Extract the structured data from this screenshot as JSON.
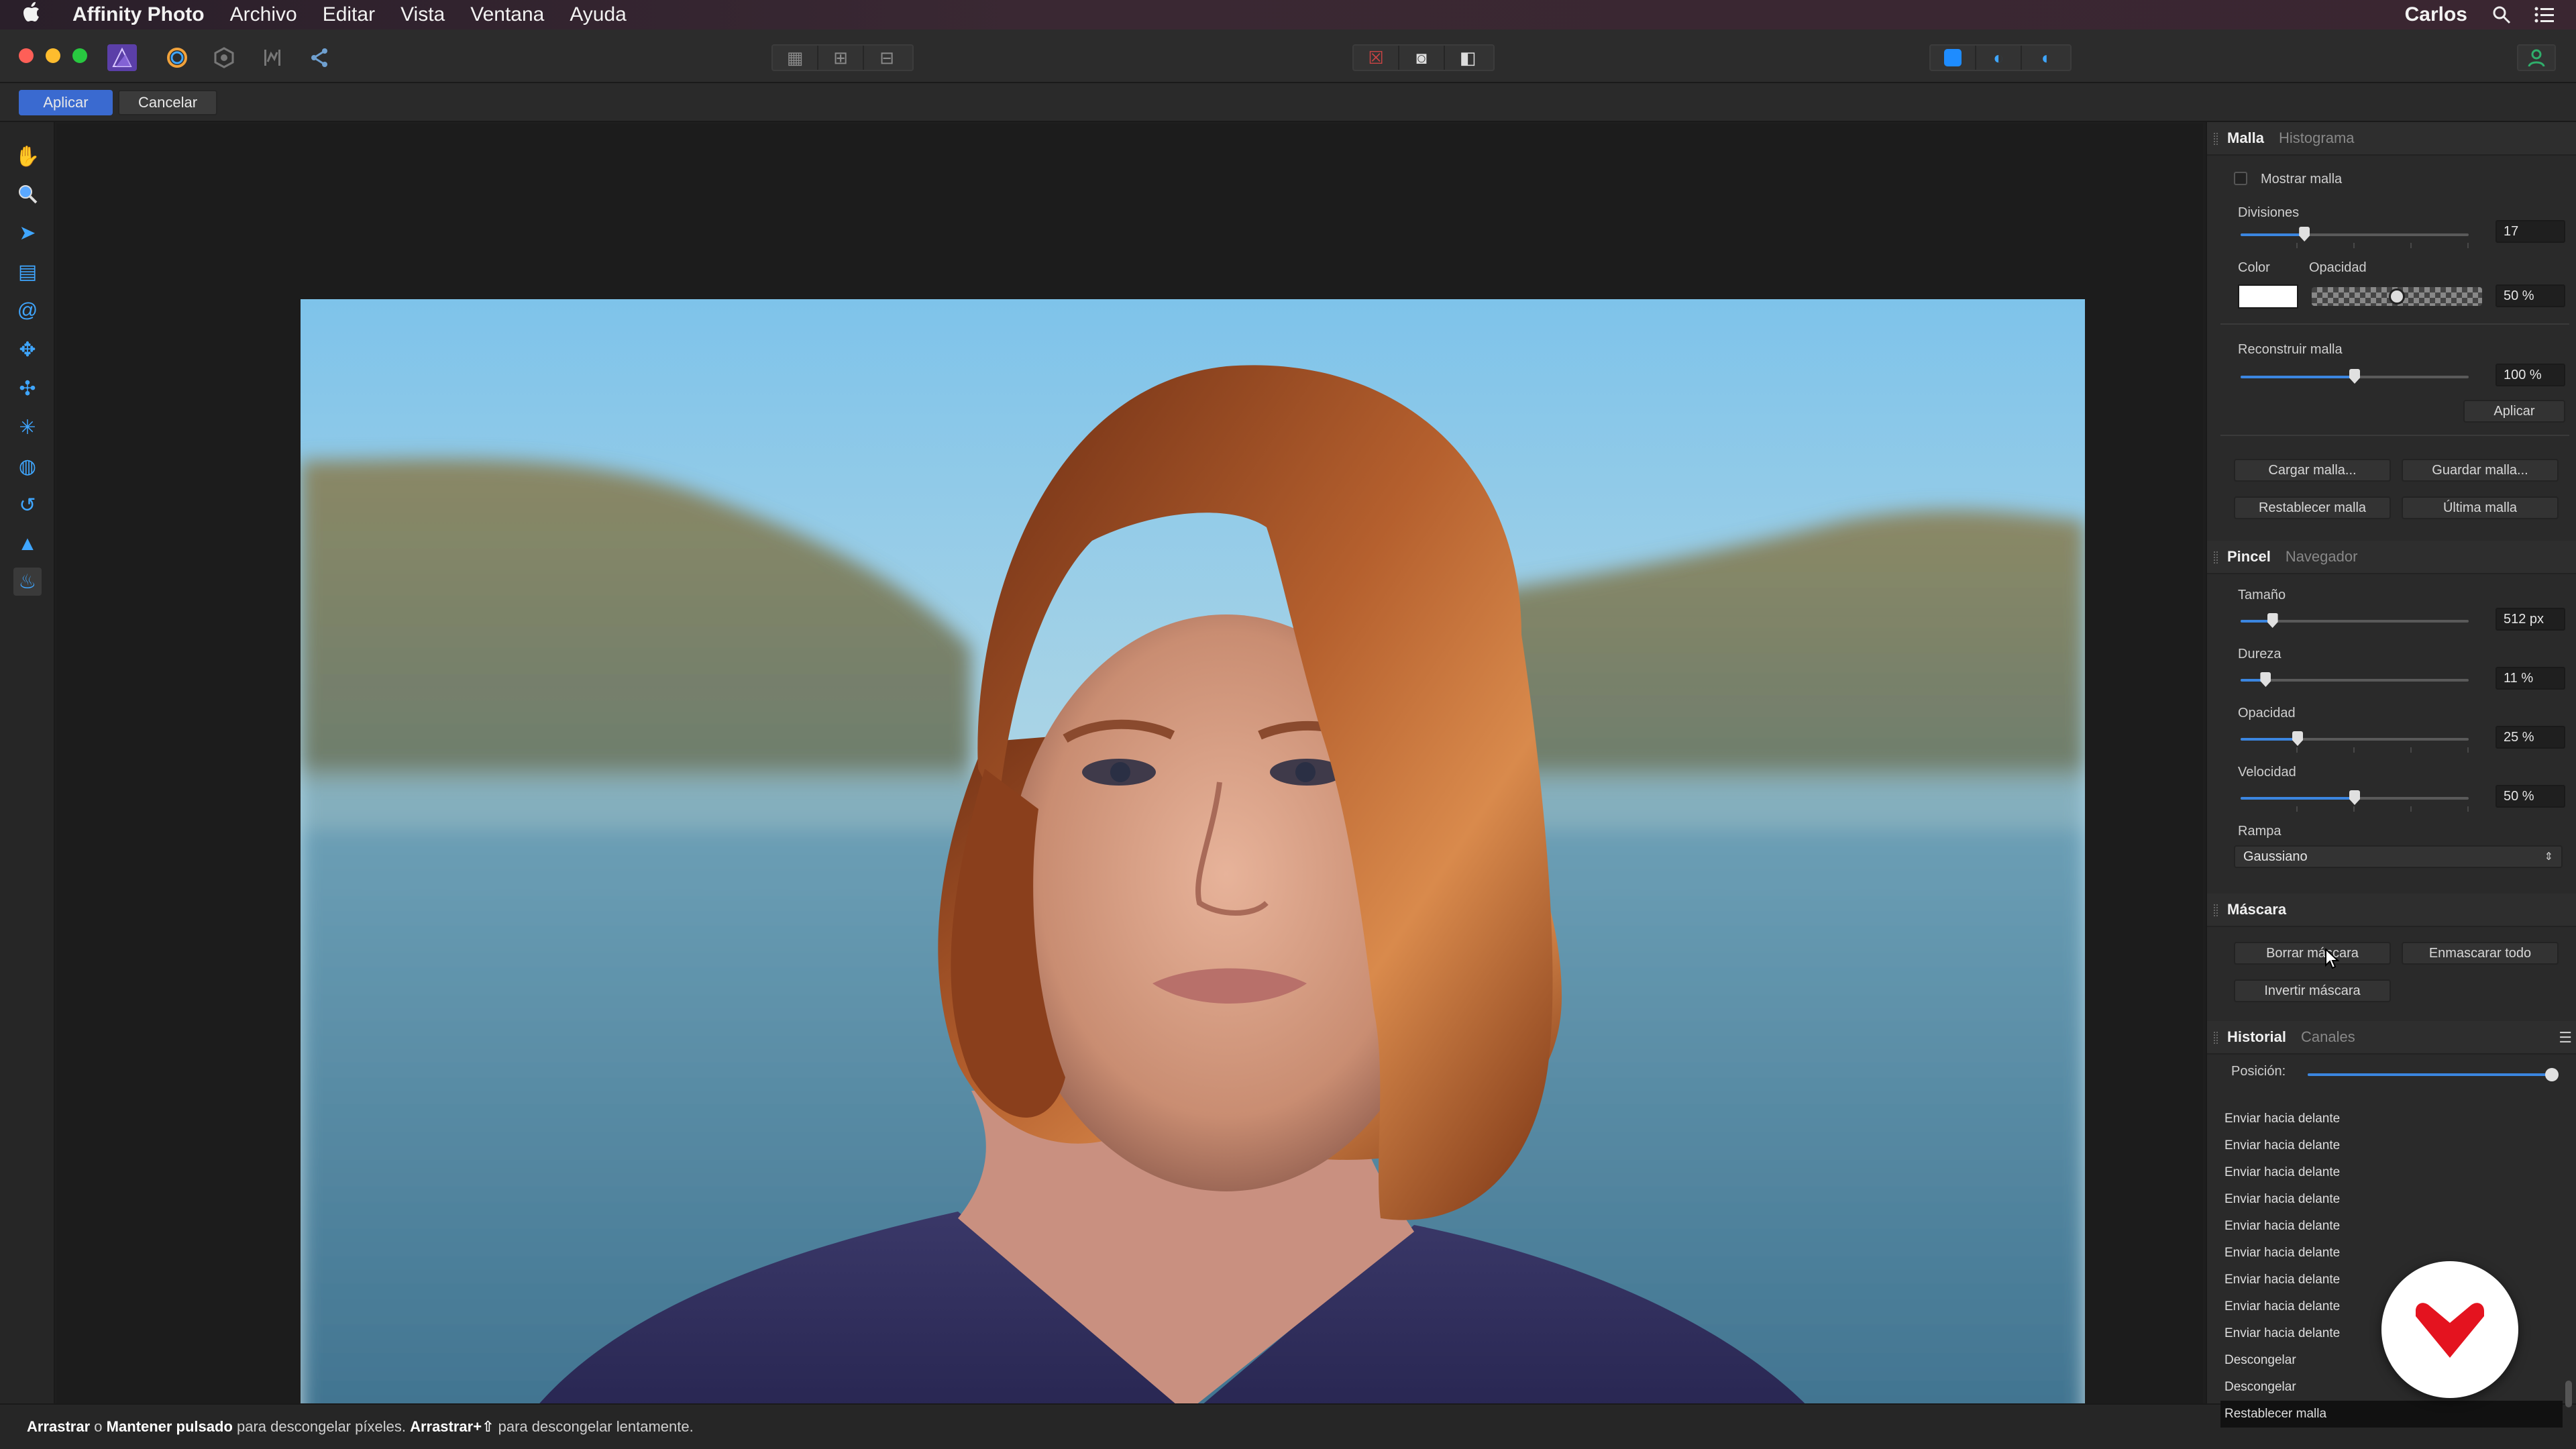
{
  "menubar": {
    "apple": "",
    "app_name": "Affinity Photo",
    "items": [
      "Archivo",
      "Editar",
      "Vista",
      "Ventana",
      "Ayuda"
    ],
    "user": "Carlos"
  },
  "context": {
    "apply": "Aplicar",
    "cancel": "Cancelar"
  },
  "status": {
    "drag": "Arrastrar",
    "o": " o ",
    "hold": "Mantener pulsado",
    "text1": " para descongelar píxeles. ",
    "drag_shift": "Arrastrar+⇧",
    "text2": " para descongelar lentamente."
  },
  "mesh_panel": {
    "tabs": [
      "Malla",
      "Histograma"
    ],
    "show_mesh": "Mostrar malla",
    "divisions_label": "Divisiones",
    "divisions_value": "17",
    "divisions_level": 0.28,
    "color_label": "Color",
    "color_value": "#ffffff",
    "opacity_label": "Opacidad",
    "opacity_value": "50 %",
    "opacity_level": 0.5,
    "rebuild_label": "Reconstruir malla",
    "rebuild_value": "100 %",
    "rebuild_level": 0.5,
    "apply": "Aplicar",
    "load": "Cargar malla...",
    "save": "Guardar malla...",
    "reset": "Restablecer malla",
    "last": "Última malla"
  },
  "brush_panel": {
    "tabs": [
      "Pincel",
      "Navegador"
    ],
    "size_label": "Tamaño",
    "size_value": "512 px",
    "size_level": 0.14,
    "hardness_label": "Dureza",
    "hardness_value": "11 %",
    "hardness_level": 0.11,
    "opacity_label": "Opacidad",
    "opacity_value": "25 %",
    "opacity_level": 0.25,
    "speed_label": "Velocidad",
    "speed_value": "50 %",
    "speed_level": 0.5,
    "ramp_label": "Rampa",
    "ramp_value": "Gaussiano"
  },
  "mask_panel": {
    "title": "Máscara",
    "clear": "Borrar máscara",
    "mask_all": "Enmascarar todo",
    "invert": "Invertir máscara"
  },
  "history_panel": {
    "tabs": [
      "Historial",
      "Canales"
    ],
    "position_label": "Posición:",
    "items": [
      "Enviar hacia delante",
      "Enviar hacia delante",
      "Enviar hacia delante",
      "Enviar hacia delante",
      "Enviar hacia delante",
      "Enviar hacia delante",
      "Enviar hacia delante",
      "Enviar hacia delante",
      "Enviar hacia delante",
      "Descongelar",
      "Descongelar",
      "Restablecer malla"
    ]
  },
  "colors": {
    "accent": "#3b86e0",
    "apply_button": "#3a6ad0",
    "badge_red": "#e4131f"
  }
}
